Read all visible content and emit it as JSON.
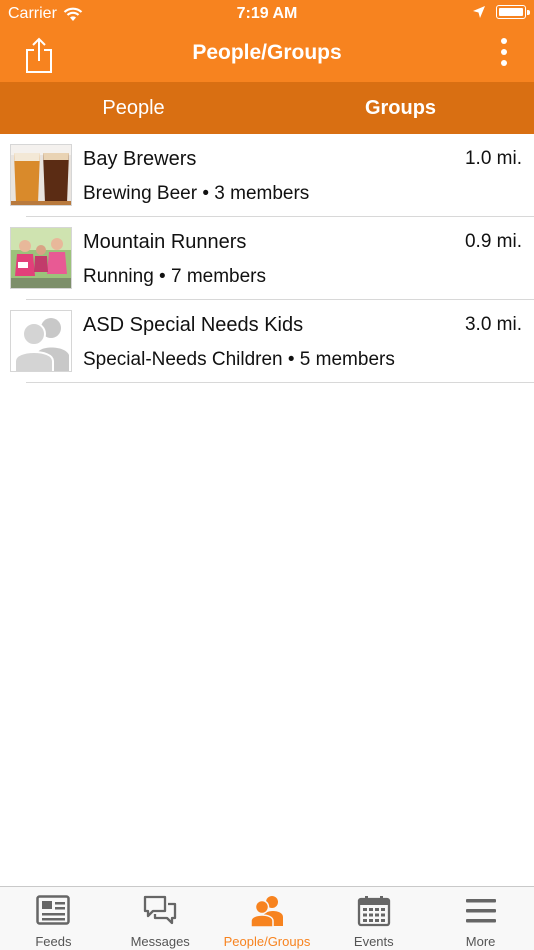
{
  "status_bar": {
    "carrier": "Carrier",
    "time": "7:19 AM"
  },
  "nav": {
    "title": "People/Groups",
    "share_icon": "share-icon",
    "more_icon": "more-vertical-icon"
  },
  "segments": [
    {
      "label": "People",
      "active": false
    },
    {
      "label": "Groups",
      "active": true
    }
  ],
  "groups": [
    {
      "name": "Bay Brewers",
      "distance": "1.0 mi.",
      "subtitle": "Brewing Beer • 3 members",
      "thumbnail": "beer-glasses-photo"
    },
    {
      "name": "Mountain Runners",
      "distance": "0.9 mi.",
      "subtitle": "Running • 7 members",
      "thumbnail": "runners-photo"
    },
    {
      "name": "ASD Special Needs Kids",
      "distance": "3.0 mi.",
      "subtitle": "Special-Needs Children • 5 members",
      "thumbnail": "group-placeholder-icon"
    }
  ],
  "tabbar": [
    {
      "label": "Feeds",
      "icon": "feeds-icon",
      "active": false
    },
    {
      "label": "Messages",
      "icon": "messages-icon",
      "active": false
    },
    {
      "label": "People/Groups",
      "icon": "people-icon",
      "active": true
    },
    {
      "label": "Events",
      "icon": "calendar-icon",
      "active": false
    },
    {
      "label": "More",
      "icon": "menu-icon",
      "active": false
    }
  ],
  "colors": {
    "brand": "#F7831F",
    "brand_dark": "#D96F12",
    "tab_inactive": "#555555"
  }
}
